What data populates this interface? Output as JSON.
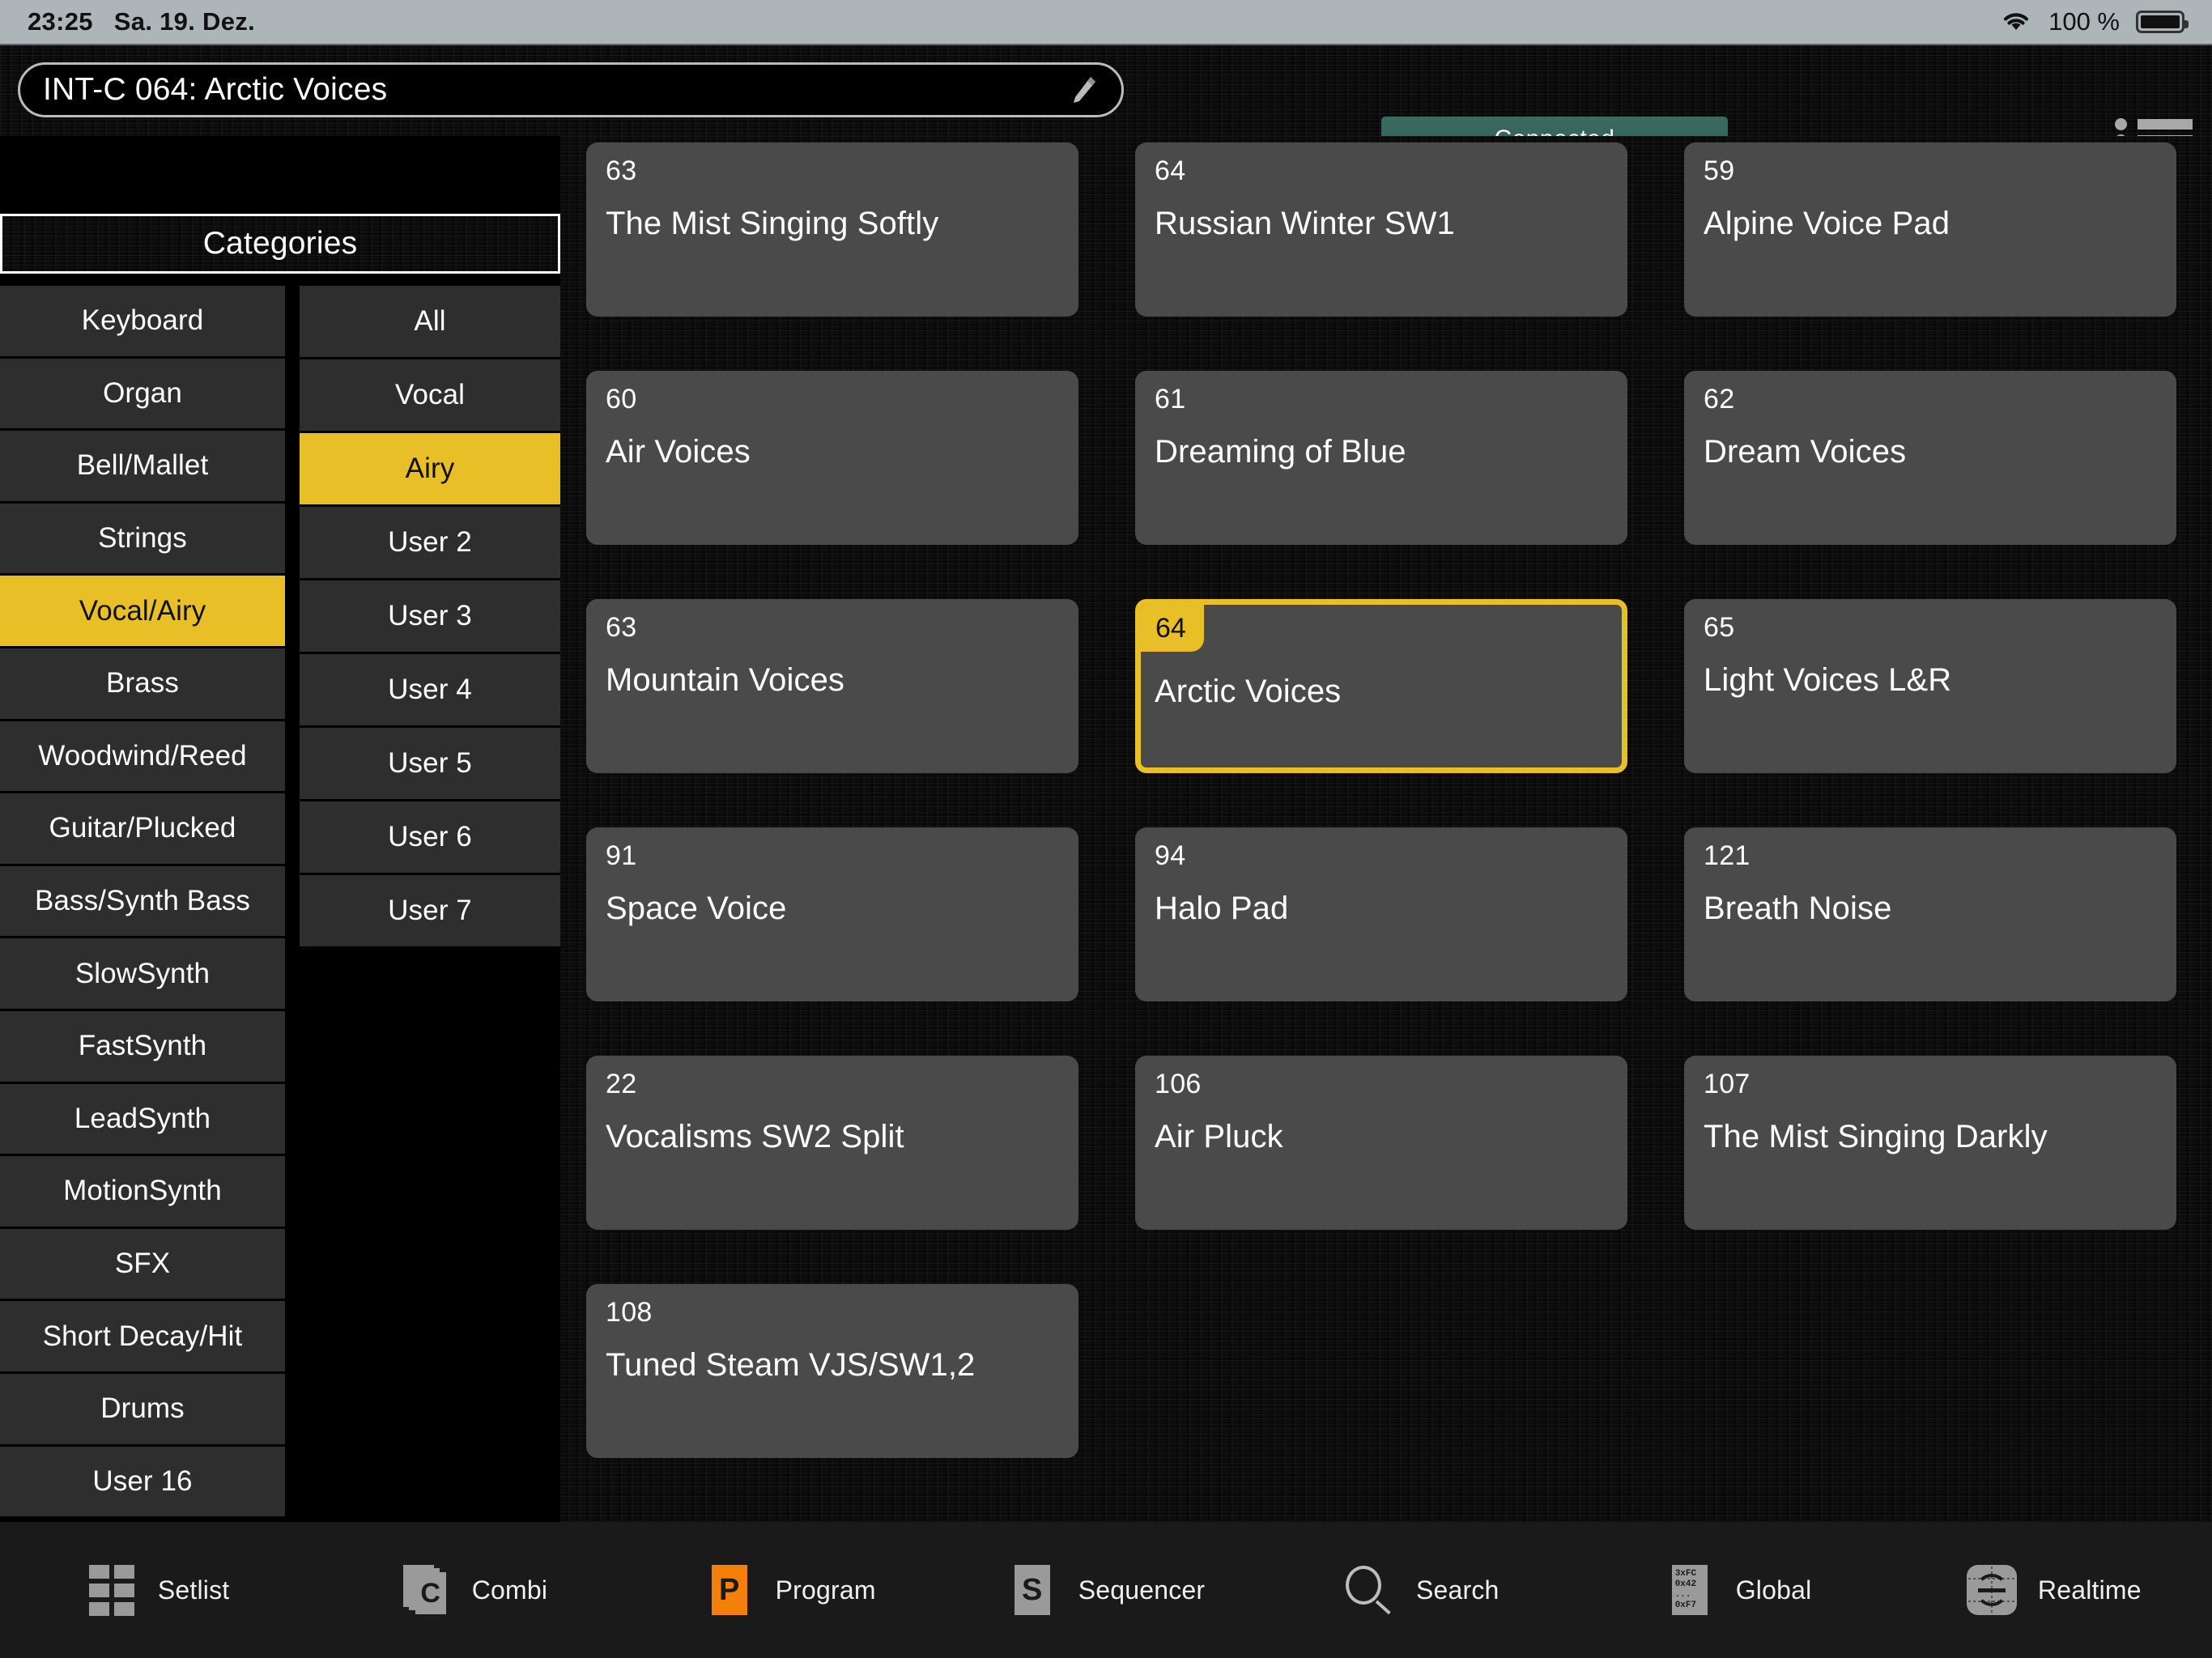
{
  "statusbar": {
    "time": "23:25",
    "date": "Sa. 19. Dez.",
    "battery_percent": "100 %",
    "wifi_icon": "wifi-icon",
    "battery_icon": "battery-icon"
  },
  "header": {
    "title_value": "INT-C 064: Arctic Voices",
    "edit_icon": "pencil-icon",
    "connection_status": "Connected",
    "menu_icon": "list-menu-icon"
  },
  "sidebar": {
    "header_label": "Categories",
    "main_categories": [
      {
        "label": "Keyboard",
        "selected": false
      },
      {
        "label": "Organ",
        "selected": false
      },
      {
        "label": "Bell/Mallet",
        "selected": false
      },
      {
        "label": "Strings",
        "selected": false
      },
      {
        "label": "Vocal/Airy",
        "selected": true
      },
      {
        "label": "Brass",
        "selected": false
      },
      {
        "label": "Woodwind/Reed",
        "selected": false
      },
      {
        "label": "Guitar/Plucked",
        "selected": false
      },
      {
        "label": "Bass/Synth Bass",
        "selected": false
      },
      {
        "label": "SlowSynth",
        "selected": false
      },
      {
        "label": "FastSynth",
        "selected": false
      },
      {
        "label": "LeadSynth",
        "selected": false
      },
      {
        "label": "MotionSynth",
        "selected": false
      },
      {
        "label": "SFX",
        "selected": false
      },
      {
        "label": "Short Decay/Hit",
        "selected": false
      },
      {
        "label": "Drums",
        "selected": false
      },
      {
        "label": "User 16",
        "selected": false
      }
    ],
    "sub_categories": [
      {
        "label": "All",
        "selected": false
      },
      {
        "label": "Vocal",
        "selected": false
      },
      {
        "label": "Airy",
        "selected": true
      },
      {
        "label": "User 2",
        "selected": false
      },
      {
        "label": "User 3",
        "selected": false
      },
      {
        "label": "User 4",
        "selected": false
      },
      {
        "label": "User 5",
        "selected": false
      },
      {
        "label": "User 6",
        "selected": false
      },
      {
        "label": "User 7",
        "selected": false
      }
    ]
  },
  "programs": [
    {
      "num": "63",
      "name": "The Mist Singing Softly",
      "selected": false
    },
    {
      "num": "64",
      "name": "Russian Winter SW1",
      "selected": false
    },
    {
      "num": "59",
      "name": "Alpine Voice Pad",
      "selected": false
    },
    {
      "num": "60",
      "name": "Air Voices",
      "selected": false
    },
    {
      "num": "61",
      "name": "Dreaming of Blue",
      "selected": false
    },
    {
      "num": "62",
      "name": "Dream Voices",
      "selected": false
    },
    {
      "num": "63",
      "name": "Mountain Voices",
      "selected": false
    },
    {
      "num": "64",
      "name": "Arctic Voices",
      "selected": true
    },
    {
      "num": "65",
      "name": "Light Voices L&R",
      "selected": false
    },
    {
      "num": "91",
      "name": "Space Voice",
      "selected": false
    },
    {
      "num": "94",
      "name": "Halo Pad",
      "selected": false
    },
    {
      "num": "121",
      "name": "Breath Noise",
      "selected": false
    },
    {
      "num": "22",
      "name": "Vocalisms SW2 Split",
      "selected": false
    },
    {
      "num": "106",
      "name": "Air Pluck",
      "selected": false
    },
    {
      "num": "107",
      "name": "The Mist Singing Darkly",
      "selected": false
    },
    {
      "num": "108",
      "name": "Tuned Steam VJS/SW1,2",
      "selected": false
    }
  ],
  "toolbar": [
    {
      "label": "Setlist",
      "icon": "setlist-grid-icon"
    },
    {
      "label": "Combi",
      "icon": "combi-stack-icon",
      "glyph": "C"
    },
    {
      "label": "Program",
      "icon": "program-square-icon",
      "glyph": "P"
    },
    {
      "label": "Sequencer",
      "icon": "sequencer-square-icon",
      "glyph": "S"
    },
    {
      "label": "Search",
      "icon": "search-icon"
    },
    {
      "label": "Global",
      "icon": "global-hex-icon",
      "lines": [
        "3xFC",
        "0x42",
        "...",
        "0xF7"
      ]
    },
    {
      "label": "Realtime",
      "icon": "realtime-knob-icon"
    }
  ],
  "colors": {
    "accent_yellow": "#e8bf26",
    "program_orange": "#f2800a",
    "connected_green": "#2a584e",
    "card_bg": "#4a4a4a",
    "category_bg": "#2e2e2e"
  }
}
